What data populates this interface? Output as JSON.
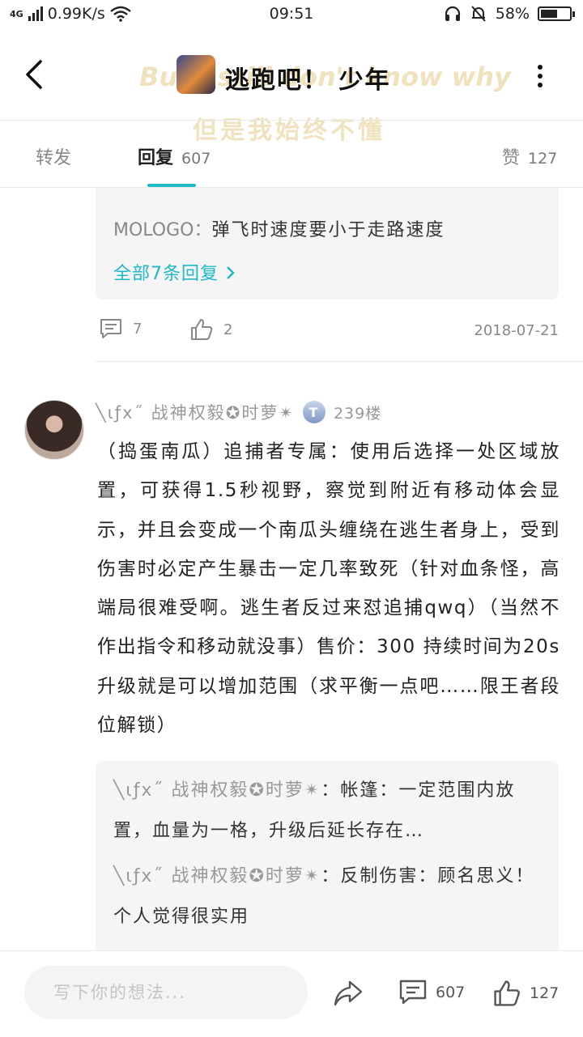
{
  "status_bar": {
    "network": "4G",
    "speed": "0.99K/s",
    "time": "09:51",
    "battery": "58%",
    "battery_level": 0.58
  },
  "header": {
    "title": "逃跑吧！ 少年",
    "watermark_line1": "But I still don't know why",
    "watermark_line2": "但是我始终不懂"
  },
  "tabs": {
    "forward": "转发",
    "reply": "回复",
    "reply_count": "607",
    "like": "赞",
    "like_count": "127"
  },
  "prev_post": {
    "reply_user": "MOLOGO",
    "reply_sep": "：",
    "reply_text": "弹飞时速度要小于走路速度",
    "view_all": "全部7条回复",
    "comment_count": "7",
    "like_count": "2",
    "date": "2018-07-21"
  },
  "post": {
    "user": "╲ιƒx˝ 战神权毅✪时萝✴",
    "badge": "T",
    "floor": "239楼",
    "body": "（捣蛋南瓜）追捕者专属：使用后选择一处区域放置，可获得1.5秒视野，察觉到附近有移动体会显示，并且会变成一个南瓜头缠绕在逃生者身上，受到伤害时必定产生暴击一定几率致死（针对血条怪，高端局很难受啊。逃生者反过来怼追捕qwq）（当然不作出指令和移动就没事）售价：300 持续时间为20s 升级就是可以增加范围（求平衡一点吧……限王者段位解锁）",
    "sub_replies": [
      {
        "user": "╲ιƒx˝ 战神权毅✪时萝✴",
        "sep": "：",
        "text": "帐篷：一定范围内放置，血量为一格，升级后延长存在…"
      },
      {
        "user": "╲ιƒx˝ 战神权毅✪时萝✴",
        "sep": "：",
        "text": "反制伤害：顾名思义！个人觉得很实用"
      }
    ]
  },
  "bottom_bar": {
    "input_placeholder": "写下你的想法...",
    "comment_count": "607",
    "like_count": "127"
  },
  "colors": {
    "accent": "#1fb8c8",
    "muted": "#999999",
    "panel": "#f5f5f5"
  }
}
